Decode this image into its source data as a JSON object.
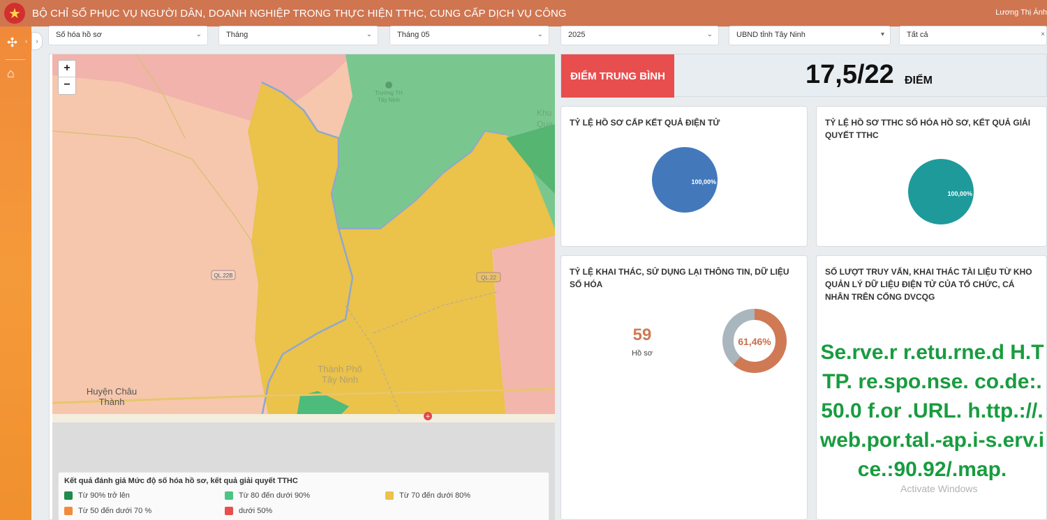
{
  "header": {
    "title": "BỘ CHỈ SỐ PHỤC VỤ NGƯỜI DÂN, DOANH NGHIỆP TRONG THỰC HIỆN TTHC, CUNG CẤP DỊCH VỤ CÔNG",
    "user": "Lương Thị Ánh",
    "accent": "#cf7550"
  },
  "sidebar": {
    "items": [
      {
        "icon": "compass-icon",
        "glyph": "✣"
      },
      {
        "icon": "home-icon",
        "glyph": "⌂"
      }
    ],
    "color": "#f08a3a"
  },
  "filters": [
    {
      "value": "Số hóa hồ sơ"
    },
    {
      "value": "Tháng"
    },
    {
      "value": "Tháng 05"
    },
    {
      "value": "2025"
    },
    {
      "value": "UBND tỉnh Tây Ninh"
    },
    {
      "value": "Tất cả"
    }
  ],
  "map": {
    "zoom_in": "+",
    "zoom_out": "−",
    "labels": {
      "road1": "QL.22B",
      "road2": "QL.22",
      "district": "Huyện Châu",
      "district2": "Thành",
      "city": "Thành Phố",
      "city2": "Tây Ninh",
      "poi": "Khu",
      "poi2": "Qua",
      "poi3": "Trường TH",
      "poi4": "Tây Ninh"
    },
    "legend": {
      "title": "Kết quả đánh giá Mức độ số hóa hồ sơ, kết quả giải quyết TTHC",
      "items": [
        {
          "label": "Từ 90% trở lên",
          "color": "#1f8a4c"
        },
        {
          "label": "Từ 80 đến dưới 90%",
          "color": "#4cc484"
        },
        {
          "label": "Từ 70 đến dưới 80%",
          "color": "#ebc24a"
        },
        {
          "label": "Từ 50 đến dưới 70 %",
          "color": "#f28a3a"
        },
        {
          "label": "dưới 50%",
          "color": "#e94e4e"
        }
      ]
    }
  },
  "average": {
    "label": "ĐIỂM TRUNG BÌNH",
    "value": "17,5/22",
    "unit": "ĐIỂM"
  },
  "cards": {
    "electronic_results": {
      "title": "TỶ LỆ HỒ SƠ CẤP KẾT QUẢ ĐIỆN TỬ",
      "pie_label": "100,00%",
      "percent": 100,
      "color": "#4379bb"
    },
    "digitized_records": {
      "title": "TỶ LỆ HỒ SƠ TTHC SỐ HÓA HỒ SƠ, KẾT QUẢ GIẢI QUYẾT TTHC",
      "pie_label": "100,00%",
      "percent": 100,
      "color": "#1e9a9b"
    },
    "reuse": {
      "title": "TỶ LỆ KHAI THÁC, SỬ DỤNG LẠI THÔNG TIN, DỮ LIỆU SỐ HÓA",
      "count": "59",
      "count_unit": "Hồ sơ",
      "donut_label": "61,46%",
      "percent": 61.46,
      "color_main": "#d07a55",
      "color_rest": "#aab6be"
    },
    "lookups": {
      "title": "SỐ LƯỢT TRUY VẤN, KHAI THÁC TÀI LIỆU TỪ KHO QUẢN LÝ DỮ LIỆU ĐIỆN TỬ CỦA TỔ CHỨC, CÁ NHÂN TRÊN CỔNG DVCQG",
      "error": "Se.rve.r r.etu.rne.d H.TTP. re.spo.nse. co.de:. 50.0 f.or .URL. h.ttp.://.web.por.tal.-ap.i-s.erv.ice.:90.92/.map."
    }
  },
  "watermark": "Activate Windows"
}
